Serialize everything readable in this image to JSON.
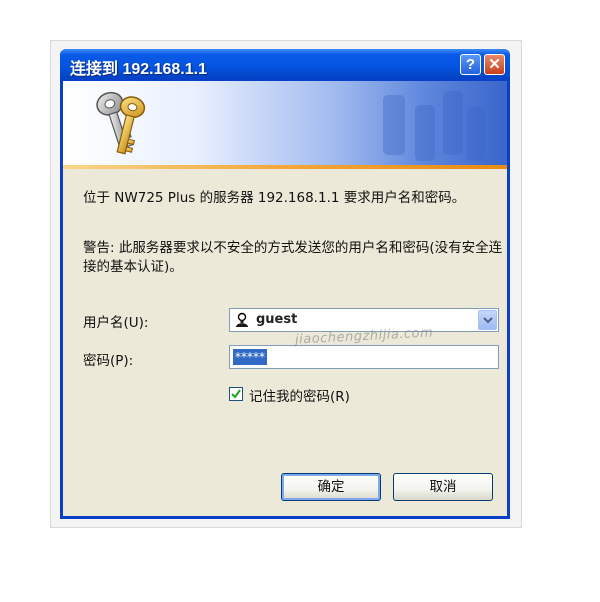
{
  "window": {
    "title": "连接到 192.168.1.1",
    "help_label": "?",
    "close_label": "✕"
  },
  "dialog": {
    "message": "位于 NW725 Plus 的服务器 192.168.1.1 要求用户名和密码。",
    "warning": "警告: 此服务器要求以不安全的方式发送您的用户名和密码(没有安全连接的基本认证)。",
    "username_label": "用户名(U):",
    "username_value": "guest",
    "password_label": "密码(P):",
    "password_value": "*****",
    "remember_label": "记住我的密码(R)",
    "remember_checked": true,
    "ok_label": "确定",
    "cancel_label": "取消"
  },
  "watermark": "jiaochengzhijia.com",
  "icons": [
    "keys-icon",
    "user-icon",
    "chevron-down-icon",
    "checkmark-icon"
  ],
  "colors": {
    "titlebar": "#0554e0",
    "dialog_bg": "#ece9d8",
    "selection": "#316ac5",
    "banner_stripe": "#f3a63a"
  }
}
